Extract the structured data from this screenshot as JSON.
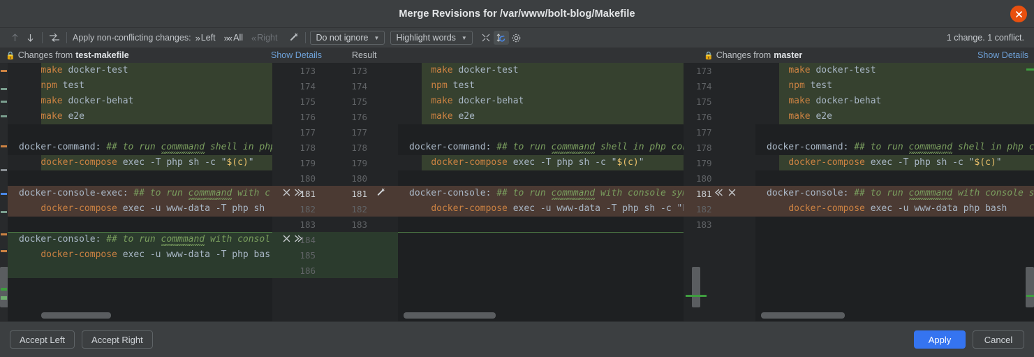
{
  "window": {
    "title": "Merge Revisions for /var/www/bolt-blog/Makefile",
    "close_icon": "close-icon"
  },
  "toolbar": {
    "prev_icon": "arrow-up-icon",
    "next_icon": "arrow-down-icon",
    "apply_icon": "apply-to-result-icon",
    "apply_label": "Apply non-conflicting changes:",
    "left_label": "Left",
    "all_label": "All",
    "right_label": "Right",
    "magic_icon": "magic-resolve-icon",
    "ignore_select": "Do not ignore",
    "highlight_select": "Highlight words",
    "collapse_icon": "collapse-unchanged-icon",
    "sync_icon": "synchronize-scroll-icon",
    "settings_icon": "gear-icon",
    "status": "1 change. 1 conflict."
  },
  "headers": {
    "left_prefix": "Changes from",
    "left_branch": "test-makefile",
    "left_details": "Show Details",
    "result_label": "Result",
    "right_prefix": "Changes from",
    "right_branch": "master",
    "right_details": "Show Details",
    "lock_icon": "lock-icon"
  },
  "left_pane": {
    "lines": [
      {
        "text": "    make docker-test",
        "bg": "green"
      },
      {
        "text": "    npm test",
        "bg": "green"
      },
      {
        "text": "    make docker-behat",
        "bg": "green"
      },
      {
        "text": "    make e2e",
        "bg": "green"
      },
      {
        "text": "",
        "bg": "none"
      },
      {
        "text": "docker-command: ## to run commmand shell in php",
        "bg": "none"
      },
      {
        "text": "    docker-compose exec -T php sh -c \"$(c)\"",
        "bg": "green"
      },
      {
        "text": "",
        "bg": "none"
      },
      {
        "text": "docker-console-exec: ## to run commmand with c",
        "bg": "conflict"
      },
      {
        "text": "    docker-compose exec -u www-data -T php sh",
        "bg": "conflict"
      },
      {
        "text": "",
        "bg": "none"
      },
      {
        "text": "docker-console: ## to run commmand with consol",
        "bg": "insert"
      },
      {
        "text": "    docker-compose exec -u www-data -T php bas",
        "bg": "insert"
      },
      {
        "text": "",
        "bg": "insert"
      }
    ]
  },
  "gutter_left": {
    "rows": [
      {
        "a": "173",
        "b": "173",
        "hl": false,
        "bg": "none",
        "actions": false,
        "magic": false
      },
      {
        "a": "174",
        "b": "174",
        "hl": false,
        "bg": "none",
        "actions": false,
        "magic": false
      },
      {
        "a": "175",
        "b": "175",
        "hl": false,
        "bg": "none",
        "actions": false,
        "magic": false
      },
      {
        "a": "176",
        "b": "176",
        "hl": false,
        "bg": "none",
        "actions": false,
        "magic": false
      },
      {
        "a": "177",
        "b": "177",
        "hl": false,
        "bg": "none",
        "actions": false,
        "magic": false
      },
      {
        "a": "178",
        "b": "178",
        "hl": false,
        "bg": "none",
        "actions": false,
        "magic": false
      },
      {
        "a": "179",
        "b": "179",
        "hl": false,
        "bg": "none",
        "actions": false,
        "magic": false
      },
      {
        "a": "180",
        "b": "180",
        "hl": false,
        "bg": "none",
        "actions": false,
        "magic": false
      },
      {
        "a": "181",
        "b": "181",
        "hl": true,
        "bg": "conflict",
        "actions": true,
        "magic": true
      },
      {
        "a": "182",
        "b": "182",
        "hl": false,
        "bg": "conflict",
        "actions": false,
        "magic": false
      },
      {
        "a": "183",
        "b": "183",
        "hl": false,
        "bg": "none",
        "actions": false,
        "magic": false
      },
      {
        "a": "184",
        "b": "",
        "hl": false,
        "bg": "insert",
        "actions": true,
        "magic": false
      },
      {
        "a": "185",
        "b": "",
        "hl": false,
        "bg": "insert",
        "actions": false,
        "magic": false
      },
      {
        "a": "186",
        "b": "",
        "hl": false,
        "bg": "insert",
        "actions": false,
        "magic": false
      }
    ],
    "accept_icon": "x-revert-icon",
    "apply_icon": "chevron-double-right-icon",
    "magic_icon": "magic-resolve-icon"
  },
  "result_pane": {
    "lines": [
      {
        "text": "    make docker-test",
        "bg": "green"
      },
      {
        "text": "    npm test",
        "bg": "green"
      },
      {
        "text": "    make docker-behat",
        "bg": "green"
      },
      {
        "text": "    make e2e",
        "bg": "green"
      },
      {
        "text": "",
        "bg": "none"
      },
      {
        "text": "docker-command: ## to run commmand shell in php con",
        "bg": "none"
      },
      {
        "text": "    docker-compose exec -T php sh -c \"$(c)\"",
        "bg": "green"
      },
      {
        "text": "",
        "bg": "none"
      },
      {
        "text": "docker-console: ## to run commmand with console sym",
        "bg": "conflict"
      },
      {
        "text": "    docker-compose exec -u www-data -T php sh -c \"b",
        "bg": "conflict"
      },
      {
        "text": "",
        "bg": "none"
      }
    ]
  },
  "gutter_right": {
    "rows": [
      {
        "n": "173",
        "hl": false,
        "bg": "none",
        "actions": false
      },
      {
        "n": "174",
        "hl": false,
        "bg": "none",
        "actions": false
      },
      {
        "n": "175",
        "hl": false,
        "bg": "none",
        "actions": false
      },
      {
        "n": "176",
        "hl": false,
        "bg": "none",
        "actions": false
      },
      {
        "n": "177",
        "hl": false,
        "bg": "none",
        "actions": false
      },
      {
        "n": "178",
        "hl": false,
        "bg": "none",
        "actions": false
      },
      {
        "n": "179",
        "hl": false,
        "bg": "none",
        "actions": false
      },
      {
        "n": "180",
        "hl": false,
        "bg": "none",
        "actions": false
      },
      {
        "n": "181",
        "hl": true,
        "bg": "conflict",
        "actions": true
      },
      {
        "n": "182",
        "hl": false,
        "bg": "conflict",
        "actions": false
      },
      {
        "n": "183",
        "hl": false,
        "bg": "none",
        "actions": false
      }
    ],
    "apply_icon": "chevron-double-left-icon",
    "accept_icon": "x-revert-icon"
  },
  "right_pane": {
    "lines": [
      {
        "text": "    make docker-test",
        "bg": "green"
      },
      {
        "text": "    npm test",
        "bg": "green"
      },
      {
        "text": "    make docker-behat",
        "bg": "green"
      },
      {
        "text": "    make e2e",
        "bg": "green"
      },
      {
        "text": "",
        "bg": "none"
      },
      {
        "text": "docker-command: ## to run commmand shell in php c",
        "bg": "none"
      },
      {
        "text": "    docker-compose exec -T php sh -c \"$(c)\"",
        "bg": "green"
      },
      {
        "text": "",
        "bg": "none"
      },
      {
        "text": "docker-console: ## to run commmand with console s",
        "bg": "conflict"
      },
      {
        "text": "    docker-compose exec -u www-data php bash",
        "bg": "conflict"
      },
      {
        "text": "",
        "bg": "none"
      }
    ]
  },
  "footer": {
    "accept_left": "Accept Left",
    "accept_right": "Accept Right",
    "apply": "Apply",
    "cancel": "Cancel"
  },
  "colors": {
    "accent": "#3574f0",
    "added": "#36412f",
    "conflict": "#4b3a33",
    "close": "#e8500f",
    "link": "#6ea1d8"
  }
}
